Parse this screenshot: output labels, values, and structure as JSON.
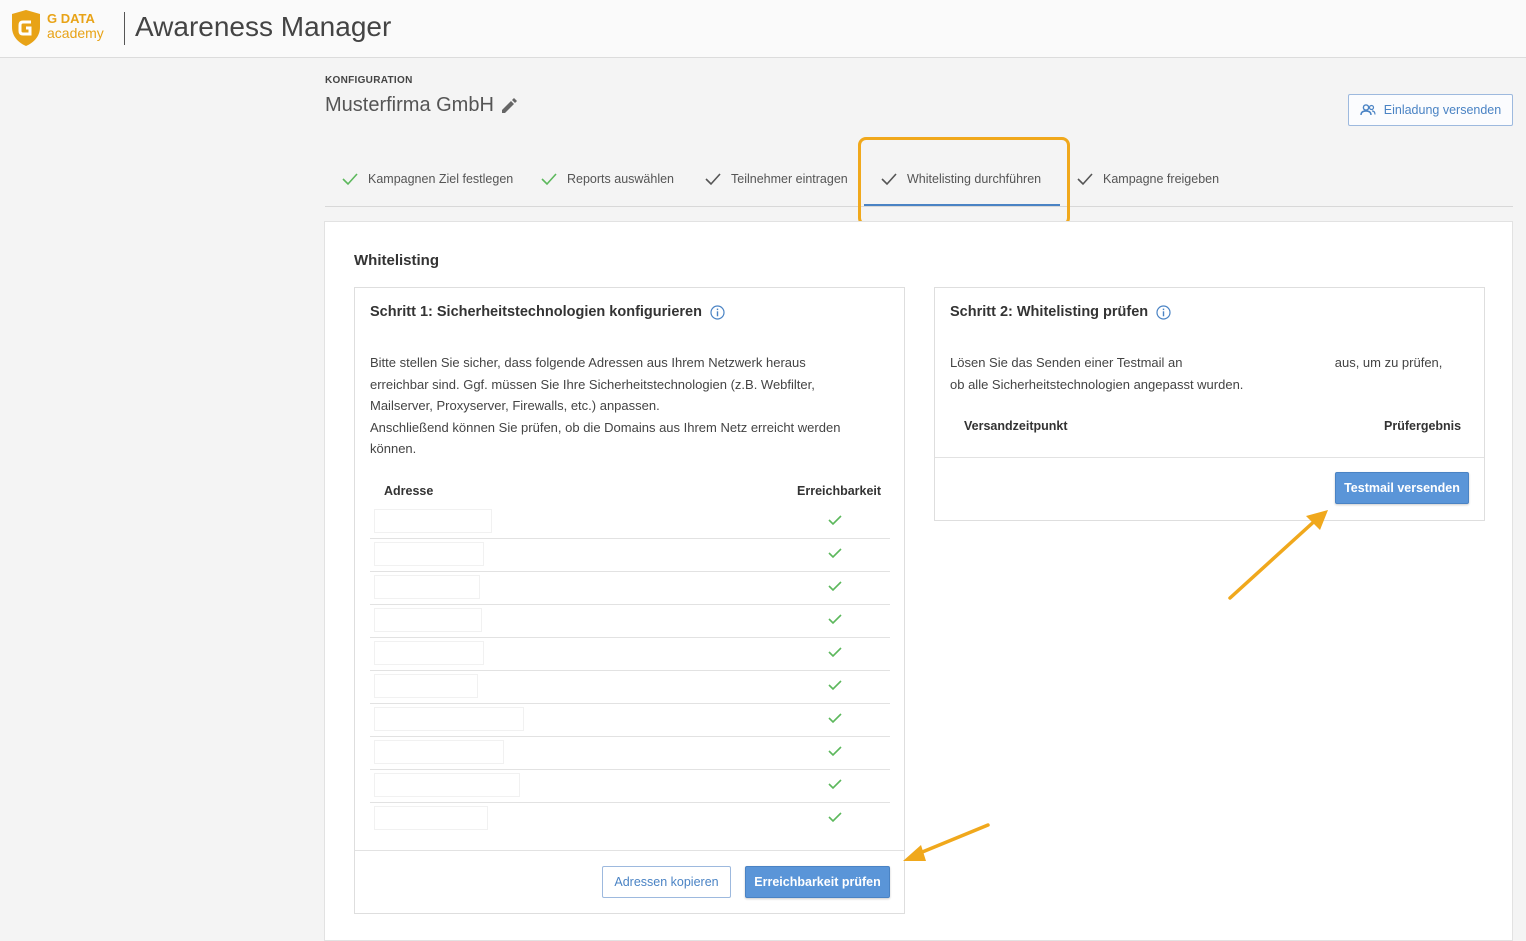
{
  "header": {
    "logo_line1": "G DATA",
    "logo_line2": "academy",
    "app_title": "Awareness Manager"
  },
  "page": {
    "breadcrumb": "KONFIGURATION",
    "company_name": "Musterfirma GmbH",
    "invite_button": "Einladung versenden"
  },
  "steps": [
    {
      "label": "Kampagnen Ziel festlegen",
      "done": true
    },
    {
      "label": "Reports auswählen",
      "done": true
    },
    {
      "label": "Teilnehmer eintragen",
      "done": false
    },
    {
      "label": "Whitelisting durchführen",
      "done": false,
      "active": true
    },
    {
      "label": "Kampagne freigeben",
      "done": false
    }
  ],
  "section_title": "Whitelisting",
  "step1": {
    "title": "Schritt 1: Sicherheitstechnologien konfigurieren",
    "text_lines": [
      "Bitte stellen Sie sicher, dass folgende Adressen aus Ihrem Netzwerk heraus",
      "erreichbar sind. Ggf. müssen Sie Ihre Sicherheitstechnologien (z.B. Webfilter,",
      "Mailserver, Proxyserver, Firewalls, etc.) anpassen.",
      "Anschließend können Sie prüfen, ob die Domains aus Ihrem Netz erreicht werden",
      "können."
    ],
    "col_address": "Adresse",
    "col_reachability": "Erreichbarkeit",
    "rows_count": 10,
    "copy_button": "Adressen kopieren",
    "check_button": "Erreichbarkeit prüfen"
  },
  "step2": {
    "title": "Schritt 2: Whitelisting prüfen",
    "text_before": "Lösen Sie das Senden einer Testmail an",
    "text_after": "aus, um zu prüfen,",
    "text_line2": "ob alle Sicherheitstechnologien angepasst wurden.",
    "col_sent": "Versandzeitpunkt",
    "col_result": "Prüfergebnis",
    "send_button": "Testmail versenden"
  },
  "colors": {
    "accent": "#4a83c4",
    "check_green": "#5cb85c",
    "highlight_orange": "#f0a81c",
    "logo_orange": "#e8a317"
  }
}
